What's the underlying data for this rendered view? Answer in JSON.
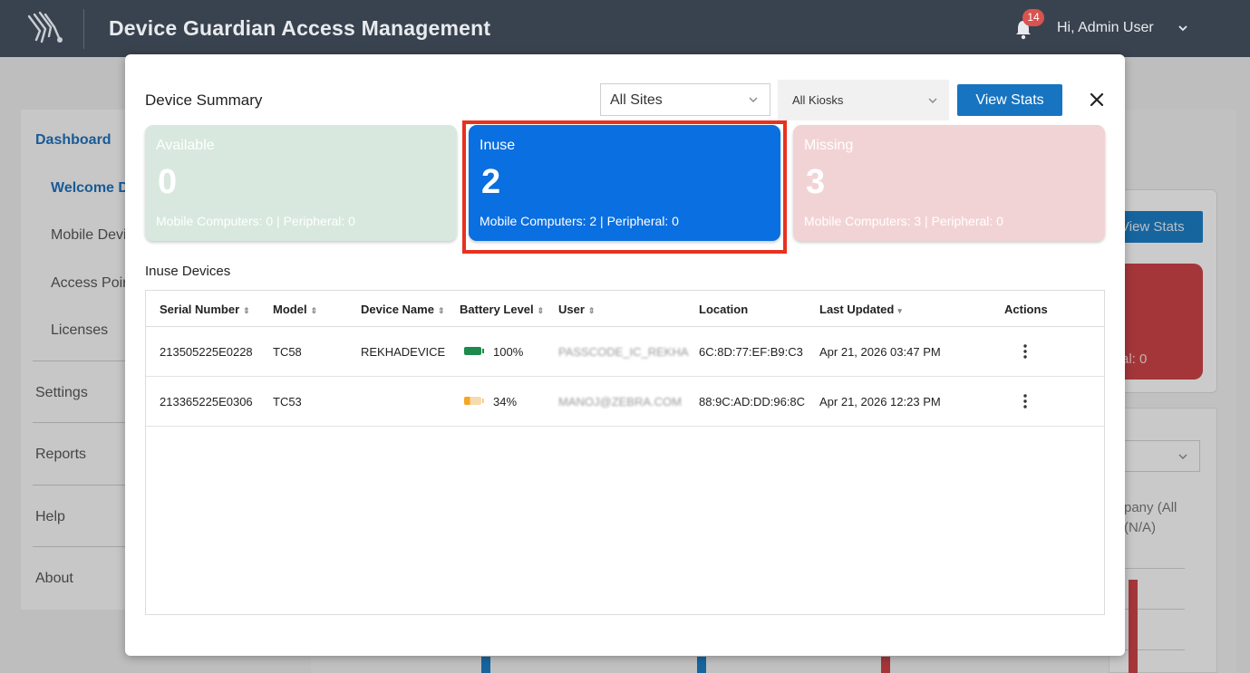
{
  "header": {
    "app_title": "Device Guardian Access Management",
    "notification_count": "14",
    "greeting": "Hi, Admin User"
  },
  "sidebar": {
    "items": [
      {
        "label": "Dashboard"
      },
      {
        "label": "Welcome D"
      },
      {
        "label": "Mobile Devic"
      },
      {
        "label": "Access Poin"
      },
      {
        "label": "Licenses"
      },
      {
        "label": "Settings"
      },
      {
        "label": "Reports"
      },
      {
        "label": "Help"
      },
      {
        "label": "About"
      }
    ]
  },
  "background": {
    "view_stats": "View Stats",
    "peripheral_fragment": "ral: 0",
    "chart_fragment_1": "pany (All",
    "chart_fragment_2": "(N/A)"
  },
  "modal": {
    "title": "Device Summary",
    "site_select": "All Sites",
    "kiosk_select": "All Kiosks",
    "view_stats": "View Stats",
    "cards": {
      "available": {
        "label": "Available",
        "count": "0",
        "detail": "Mobile Computers: 0 | Peripheral: 0"
      },
      "inuse": {
        "label": "Inuse",
        "count": "2",
        "detail": "Mobile Computers: 2 | Peripheral: 0"
      },
      "missing": {
        "label": "Missing",
        "count": "3",
        "detail": "Mobile Computers: 3 | Peripheral: 0"
      }
    },
    "table_title": "Inuse Devices",
    "columns": {
      "serial": "Serial Number",
      "model": "Model",
      "device_name": "Device Name",
      "battery": "Battery Level",
      "user": "User",
      "location": "Location",
      "last_updated": "Last Updated",
      "actions": "Actions"
    },
    "rows": [
      {
        "serial": "213505225E0228",
        "model": "TC58",
        "device_name": "REKHADEVICE",
        "battery": "100%",
        "battery_level": 1.0,
        "battery_color": "#1e8a4c",
        "user": "PASSCODE_IC_REKHA",
        "location": "6C:8D:77:EF:B9:C3",
        "last_updated": "Apr 21, 2026 03:47 PM"
      },
      {
        "serial": "213365225E0306",
        "model": "TC53",
        "device_name": "",
        "battery": "34%",
        "battery_level": 0.34,
        "battery_color": "#f5a623",
        "user": "MANOJ@ZEBRA.COM",
        "location": "88:9C:AD:DD:96:8C",
        "last_updated": "Apr 21, 2026 12:23 PM"
      }
    ]
  },
  "colors": {
    "header_bg": "#39434f",
    "accent_blue": "#1674c0",
    "inuse_card": "#0a6fe0",
    "available_card": "#d8e8de",
    "missing_card": "#f2d3d5",
    "highlight": "#e8311f",
    "badge": "#d9534f"
  }
}
